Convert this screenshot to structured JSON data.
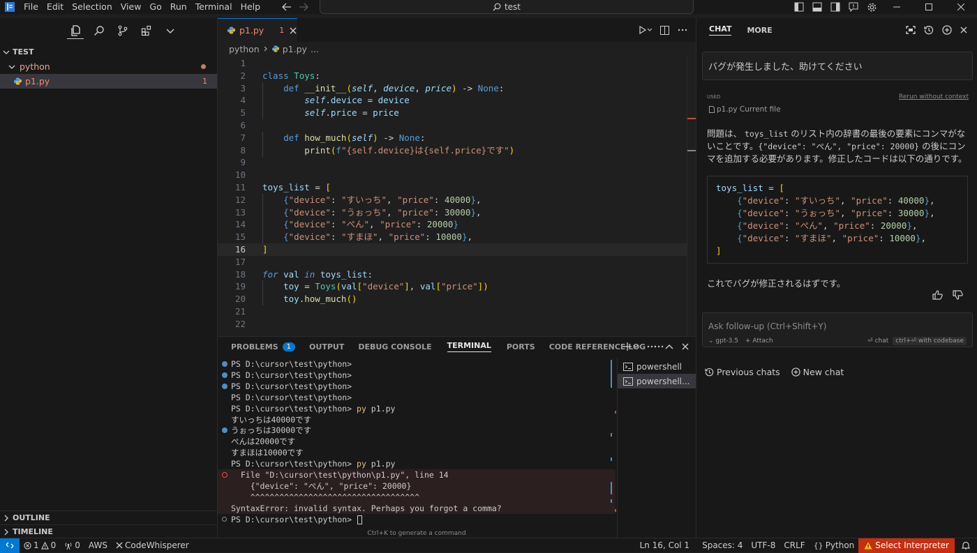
{
  "menu": [
    "File",
    "Edit",
    "Selection",
    "View",
    "Go",
    "Run",
    "Terminal",
    "Help"
  ],
  "search": {
    "text": "test"
  },
  "explorer": {
    "root": "TEST",
    "folder": "python",
    "file": "p1.py",
    "file_badge": "1",
    "outline": "OUTLINE",
    "timeline": "TIMELINE"
  },
  "editor": {
    "tab_name": "p1.py",
    "tab_badge": "1",
    "breadcrumb": [
      "python",
      "p1.py",
      "..."
    ]
  },
  "code_lines": [
    "",
    "class Toys:",
    "    def __init__(self, device, price) -> None:",
    "        self.device = device",
    "        self.price = price",
    "",
    "    def how_much(self) -> None:",
    "        print(f\"{self.device}は{self.price}です\")",
    "",
    "",
    "toys_list = [",
    "    {\"device\": \"すいっち\", \"price\": 40000},",
    "    {\"device\": \"うぉっち\", \"price\": 30000},",
    "    {\"device\": \"ぺん\", \"price\": 20000}",
    "    {\"device\": \"すまほ\", \"price\": 10000},",
    "]",
    "",
    "for val in toys_list:",
    "    toy = Toys(val[\"device\"], val[\"price\"])",
    "    toy.how_much()",
    "",
    ""
  ],
  "panel": {
    "tabs": [
      "PROBLEMS",
      "OUTPUT",
      "DEBUG CONSOLE",
      "TERMINAL",
      "PORTS",
      "CODE REFERENCE LOG"
    ],
    "problems_count": "1",
    "terminals": [
      "powershell",
      "powershell..."
    ],
    "ctrl_k_hint": "Ctrl+K to generate a command"
  },
  "terminal_lines": [
    "PS D:\\cursor\\test\\python>",
    "PS D:\\cursor\\test\\python>",
    "PS D:\\cursor\\test\\python>",
    "PS D:\\cursor\\test\\python>",
    "PS D:\\cursor\\test\\python> py p1.py",
    "すいっちは40000です",
    "うぉっちは30000です",
    "ぺんは20000です",
    "すまほは10000です",
    "PS D:\\cursor\\test\\python> py p1.py",
    "  File \"D:\\cursor\\test\\python\\p1.py\", line 14",
    "    {\"device\": \"ぺん\", \"price\": 20000}",
    "    ^^^^^^^^^^^^^^^^^^^^^^^^^^^^^^^^^^^",
    "SyntaxError: invalid syntax. Perhaps you forgot a comma?",
    "PS D:\\cursor\\test\\python> "
  ],
  "chat": {
    "tabs": [
      "CHAT",
      "MORE"
    ],
    "user_message": "バグが発生しました、助けてください",
    "used_label": "USED",
    "rerun_label": "Rerun without context",
    "context_file": "p1.py Current file",
    "answer_part1": "問題は、",
    "answer_code1": "toys_list",
    "answer_part2": "のリスト内の辞書の最後の要素にコンマがないことです。",
    "answer_code2": "{\"device\": \"ぺん\", \"price\": 20000}",
    "answer_part3": "の後にコンマを追加する必要があります。修正したコードは以下の通りです。",
    "code_block": [
      "toys_list = [",
      "    {\"device\": \"すいっち\", \"price\": 40000},",
      "    {\"device\": \"うぉっち\", \"price\": 30000},",
      "    {\"device\": \"ぺん\", \"price\": 20000},",
      "    {\"device\": \"すまほ\", \"price\": 10000},",
      "]"
    ],
    "fixed_message": "これでバグが修正されるはずです。",
    "followup_placeholder": "Ask follow-up (Ctrl+Shift+Y)",
    "model": "gpt-3.5",
    "attach": "Attach",
    "chat_label": "chat",
    "codebase_label": "ctrl+⏎ with codebase",
    "previous_chats": "Previous chats",
    "new_chat": "New chat"
  },
  "status": {
    "errors": "1",
    "warnings": "0",
    "ports": "0",
    "aws": "AWS",
    "codewhisperer": "CodeWhisperer",
    "position": "Ln 16, Col 1",
    "spaces": "Spaces: 4",
    "encoding": "UTF-8",
    "eol": "CRLF",
    "language": "Python",
    "interpreter": "Select Interpreter"
  },
  "colors": {
    "accent": "#0078d4",
    "error": "#c72e0f"
  }
}
